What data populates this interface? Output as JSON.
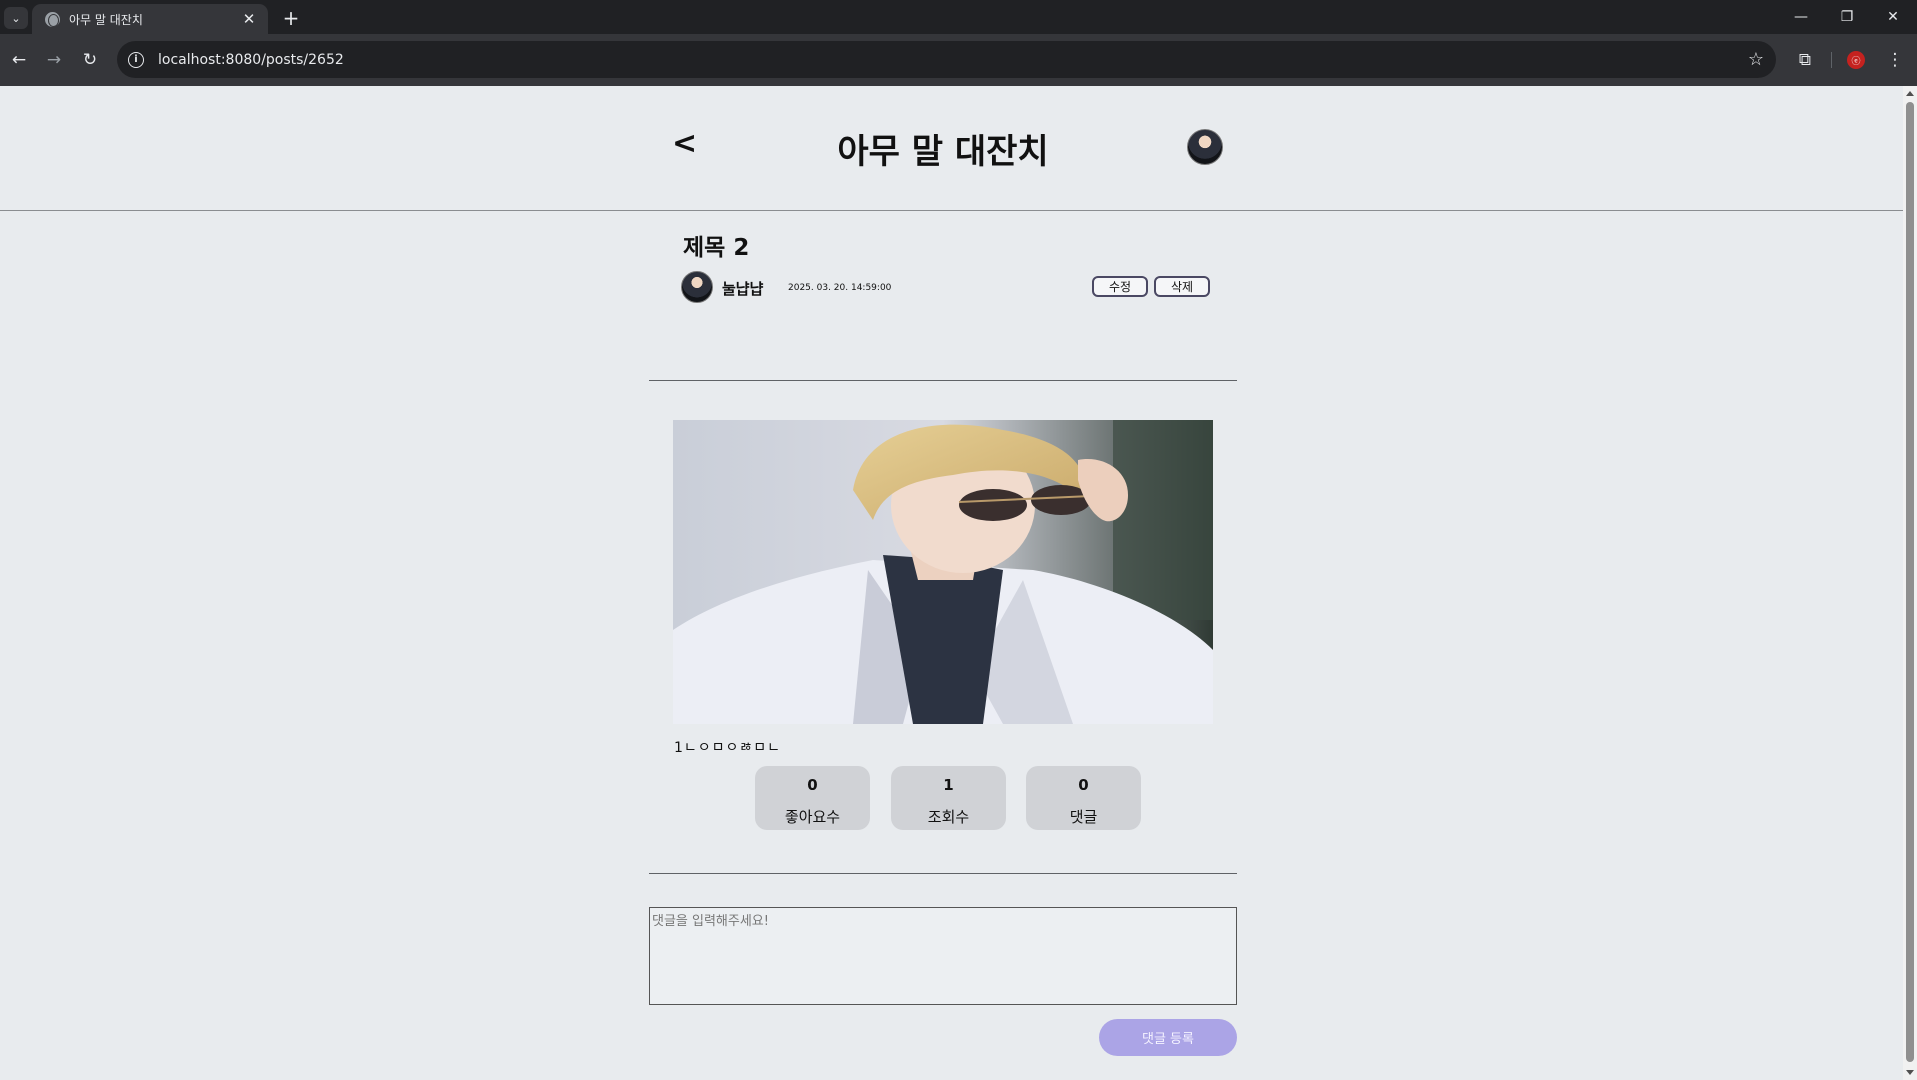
{
  "browser": {
    "tab_title": "아무 말 대잔치",
    "url": "localhost:8080/posts/2652",
    "tab_menu_icon": "chevron-down-icon",
    "new_tab_label": "+",
    "close_tab_label": "✕",
    "minimize_label": "—",
    "restore_label": "❐",
    "close_window_label": "✕",
    "back_label": "←",
    "forward_label": "→",
    "reload_label": "↻",
    "star_label": "☆",
    "extensions_label": "⧉",
    "menu_label": "⋮",
    "profile_label": "ⓔ"
  },
  "header": {
    "back_label": "<",
    "title": "아무 말 대잔치"
  },
  "post": {
    "title": "제목 2",
    "author": "눌냡냡",
    "date": "2025. 03. 20. 14:59:00",
    "edit_label": "수정",
    "delete_label": "삭제",
    "body": "1ㄴㅇㅁㅇㅀㅁㄴ"
  },
  "stats": [
    {
      "value": "0",
      "label": "좋아요수"
    },
    {
      "value": "1",
      "label": "조회수"
    },
    {
      "value": "0",
      "label": "댓글"
    }
  ],
  "comment": {
    "placeholder": "댓글을 입력해주세요!",
    "submit_label": "댓글 등록"
  },
  "colors": {
    "page_bg": "#e8ebee",
    "submit_button": "#aba4e6",
    "stat_card": "#d0d2d6"
  }
}
